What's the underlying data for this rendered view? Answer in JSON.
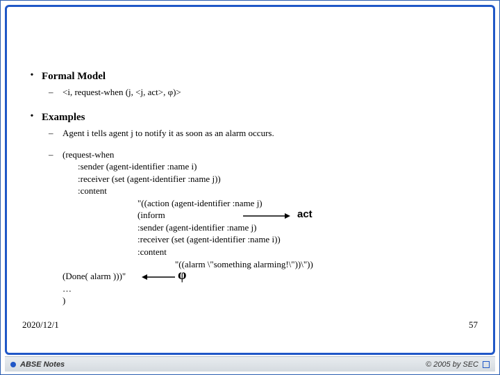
{
  "sections": {
    "formal_model": {
      "heading": "Formal Model",
      "item1": "<i, request-when (j, <j, act>, φ)>"
    },
    "examples": {
      "heading": "Examples",
      "item1": "Agent i tells agent j to notify it as soon as an alarm occurs.",
      "code": {
        "l1": "(request-when",
        "l2": ":sender (agent-identifier :name i)",
        "l3": ":receiver (set (agent-identifier :name j))",
        "l4": ":content",
        "l5": "\"((action (agent-identifier :name j)",
        "l6": "(inform",
        "l7": ":sender (agent-identifier :name j)",
        "l8": ":receiver (set (agent-identifier :name i))",
        "l9": ":content",
        "l10": "\"((alarm \\\"something alarming!\\\"))\\\"))",
        "l11": "(Done( alarm )))\"",
        "l12": "…",
        "l13": ")"
      }
    }
  },
  "annotations": {
    "act": "act",
    "phi": "φ"
  },
  "footer": {
    "date": "2020/12/1",
    "page": "57",
    "notes_label": "ABSE Notes",
    "copyright": "© 2005  by SEC"
  }
}
